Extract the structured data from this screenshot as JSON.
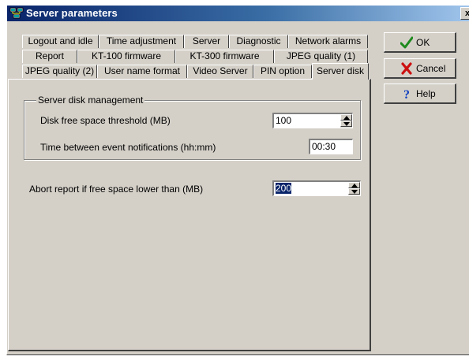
{
  "window": {
    "title": "Server parameters",
    "close_glyph": "x"
  },
  "tabs": {
    "row1": [
      "Logout and idle",
      "Time adjustment",
      "Server",
      "Diagnostic",
      "Network alarms"
    ],
    "row2": [
      "Report",
      "KT-100 firmware",
      "KT-300 firmware",
      "JPEG quality (1)"
    ],
    "row3": [
      "JPEG quality (2)",
      "User name format",
      "Video Server",
      "PIN option",
      "Server disk"
    ],
    "active": "Server disk"
  },
  "panel": {
    "group_title": "Server disk management",
    "threshold_label": "Disk free space threshold (MB)",
    "threshold_value": "100",
    "notify_label": "Time between event notifications (hh:mm)",
    "notify_value": "00:30",
    "abort_label": "Abort report if free space lower than (MB)",
    "abort_value": "200"
  },
  "buttons": {
    "ok": "OK",
    "cancel": "Cancel",
    "help": "Help"
  },
  "icons": {
    "title": "network-computers-icon",
    "ok": "checkmark-icon",
    "cancel": "red-x-icon",
    "help": "question-mark-icon"
  },
  "colors": {
    "titlebar_start": "#0a246a",
    "titlebar_end": "#a6caf0",
    "face": "#d4d0c8",
    "selection": "#0a246a",
    "ok_green": "#1e8a1e",
    "cancel_red": "#cc1010",
    "help_blue": "#1040c0"
  }
}
